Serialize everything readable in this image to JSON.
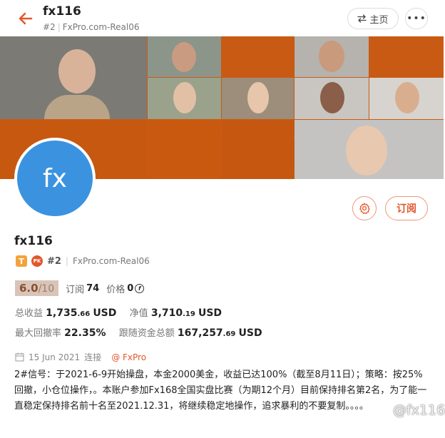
{
  "header": {
    "title": "fx116",
    "rank": "#2",
    "broker_account": "FxPro.com-Real06",
    "home_label": "主页",
    "more_label": "•••"
  },
  "profile": {
    "avatar_text": "fx",
    "name": "fx116",
    "badge_t": "T",
    "badge_pk": "PK",
    "rank": "#2",
    "broker_account": "FxPro.com-Real06",
    "subscribe_label": "订阅",
    "rating": "6.0",
    "rating_max": "/10",
    "subscribers_label": "订阅",
    "subscribers": "74",
    "price_label": "价格",
    "price": "0"
  },
  "stats": {
    "total_profit_label": "总收益",
    "total_profit_int": "1,735",
    "total_profit_dec": ".66",
    "net_value_label": "净值",
    "net_value_int": "3,710",
    "net_value_dec": ".19",
    "drawdown_label": "最大回撤率",
    "drawdown": "22.35%",
    "follow_funds_label": "跟随资金总额",
    "follow_funds_int": "167,257",
    "follow_funds_dec": ".69",
    "currency": "USD"
  },
  "meta": {
    "date": "15 Jun 2021",
    "connect_label": "连接",
    "broker": "@ FxPro"
  },
  "description": "2#信号：于2021-6-9开始操盘，本金2000美金，收益已达100%（截至8月11日）；策略：按25%回撤，小仓位操作，。本账户参加Fx168全国实盘比赛（为期12个月）目前保持排名第2名，为了能一直稳定保持排名前十名至2021.12.31，将继续稳定地操作，追求暴利的不要复制。。。。",
  "watermark": "@fx116",
  "colors": {
    "accent": "#e2572b",
    "banner_orange": "#c85a14",
    "avatar_blue": "#3b93e0",
    "badge_gold": "#f4a23c",
    "rating_bg": "#d9c4b8"
  },
  "icons": {
    "back": "arrow-left-icon",
    "home": "swap-icon",
    "more": "ellipsis-icon",
    "settings": "gear-icon",
    "calendar": "calendar-icon",
    "coin": "coin-icon"
  }
}
